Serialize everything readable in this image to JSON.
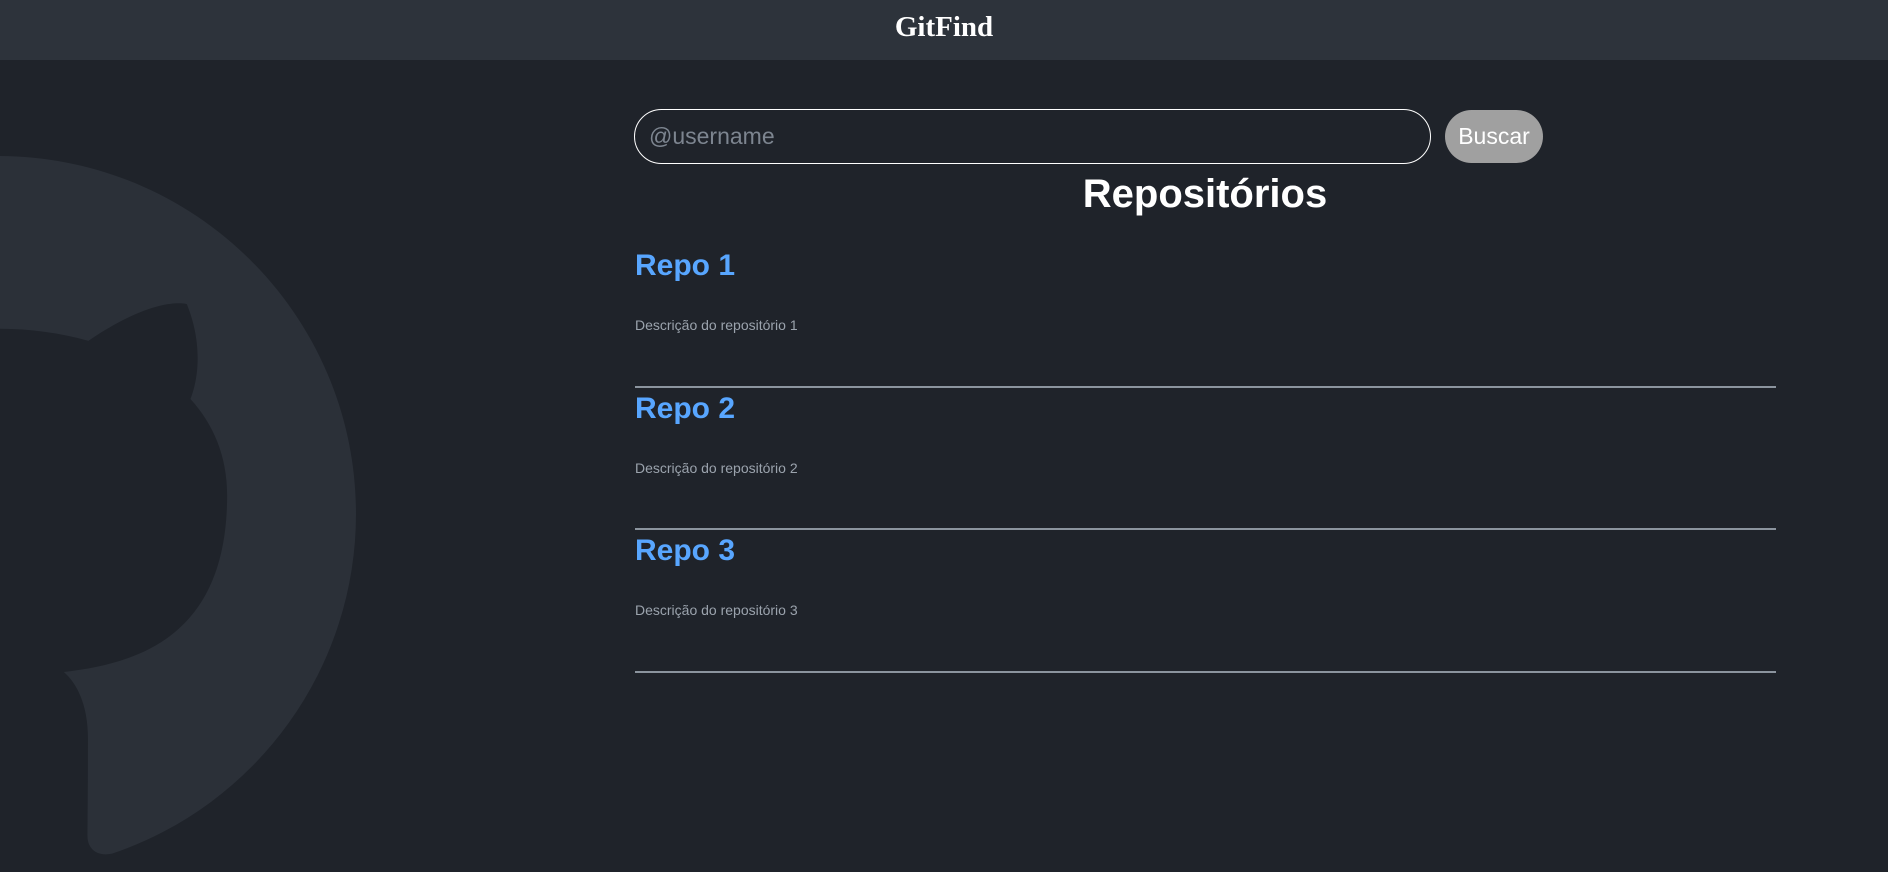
{
  "header": {
    "title": "GitFind"
  },
  "search": {
    "placeholder": "@username",
    "button_label": "Buscar"
  },
  "repositories": {
    "title": "Repositórios",
    "items": [
      {
        "name": "Repo 1",
        "description": "Descrição do repositório 1"
      },
      {
        "name": "Repo 2",
        "description": "Descrição do repositório 2"
      },
      {
        "name": "Repo 3",
        "description": "Descrição do repositório 3"
      }
    ]
  },
  "background": {
    "icon": "github-octocat-icon"
  },
  "colors": {
    "background": "#1f232a",
    "header": "#2d333b",
    "link": "#58a6ff",
    "button": "#a0a0a0",
    "divider": "#8b949e"
  }
}
